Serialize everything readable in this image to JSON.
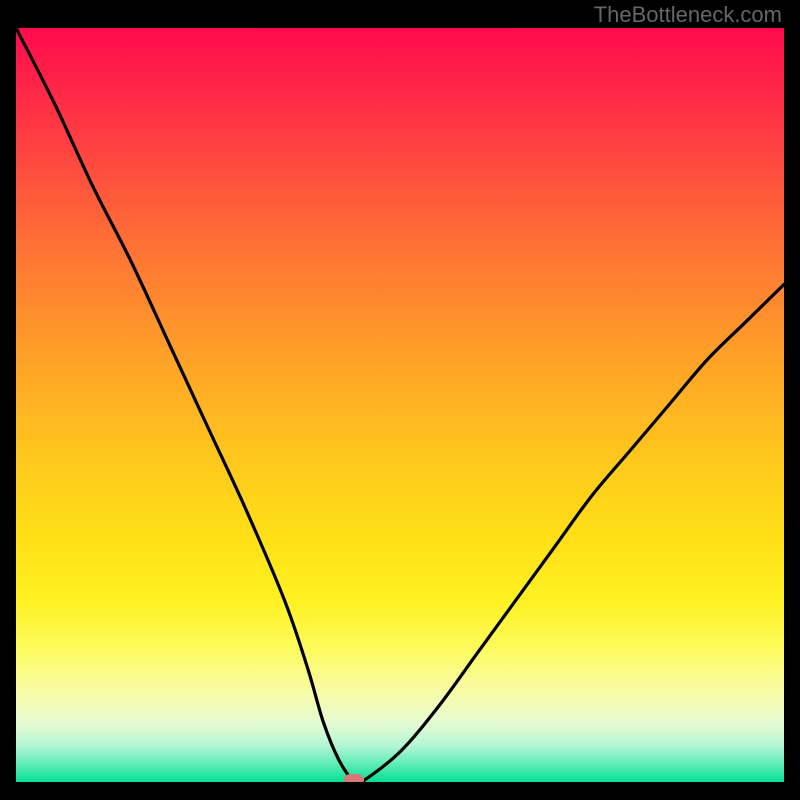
{
  "watermark": "TheBottleneck.com",
  "chart_data": {
    "type": "line",
    "title": "",
    "xlabel": "",
    "ylabel": "",
    "xlim": [
      0,
      100
    ],
    "ylim": [
      0,
      100
    ],
    "series": [
      {
        "name": "bottleneck-curve",
        "x": [
          0,
          5,
          10,
          15,
          20,
          25,
          30,
          35,
          38,
          40,
          42,
          44,
          45,
          50,
          55,
          60,
          65,
          70,
          75,
          80,
          85,
          90,
          95,
          100
        ],
        "y": [
          100,
          90,
          79,
          69,
          58,
          47,
          36,
          24,
          15,
          8,
          3,
          0,
          0,
          4,
          10,
          17,
          24,
          31,
          38,
          44,
          50,
          56,
          61,
          66
        ]
      }
    ],
    "annotations": [
      {
        "name": "optimal-marker",
        "x": 44,
        "y": 0
      }
    ],
    "gradient_stops": [
      {
        "pct": 0,
        "color": "#ff0a4d"
      },
      {
        "pct": 50,
        "color": "#ffca1c"
      },
      {
        "pct": 82,
        "color": "#fdfb5a"
      },
      {
        "pct": 100,
        "color": "#04e096"
      }
    ]
  }
}
